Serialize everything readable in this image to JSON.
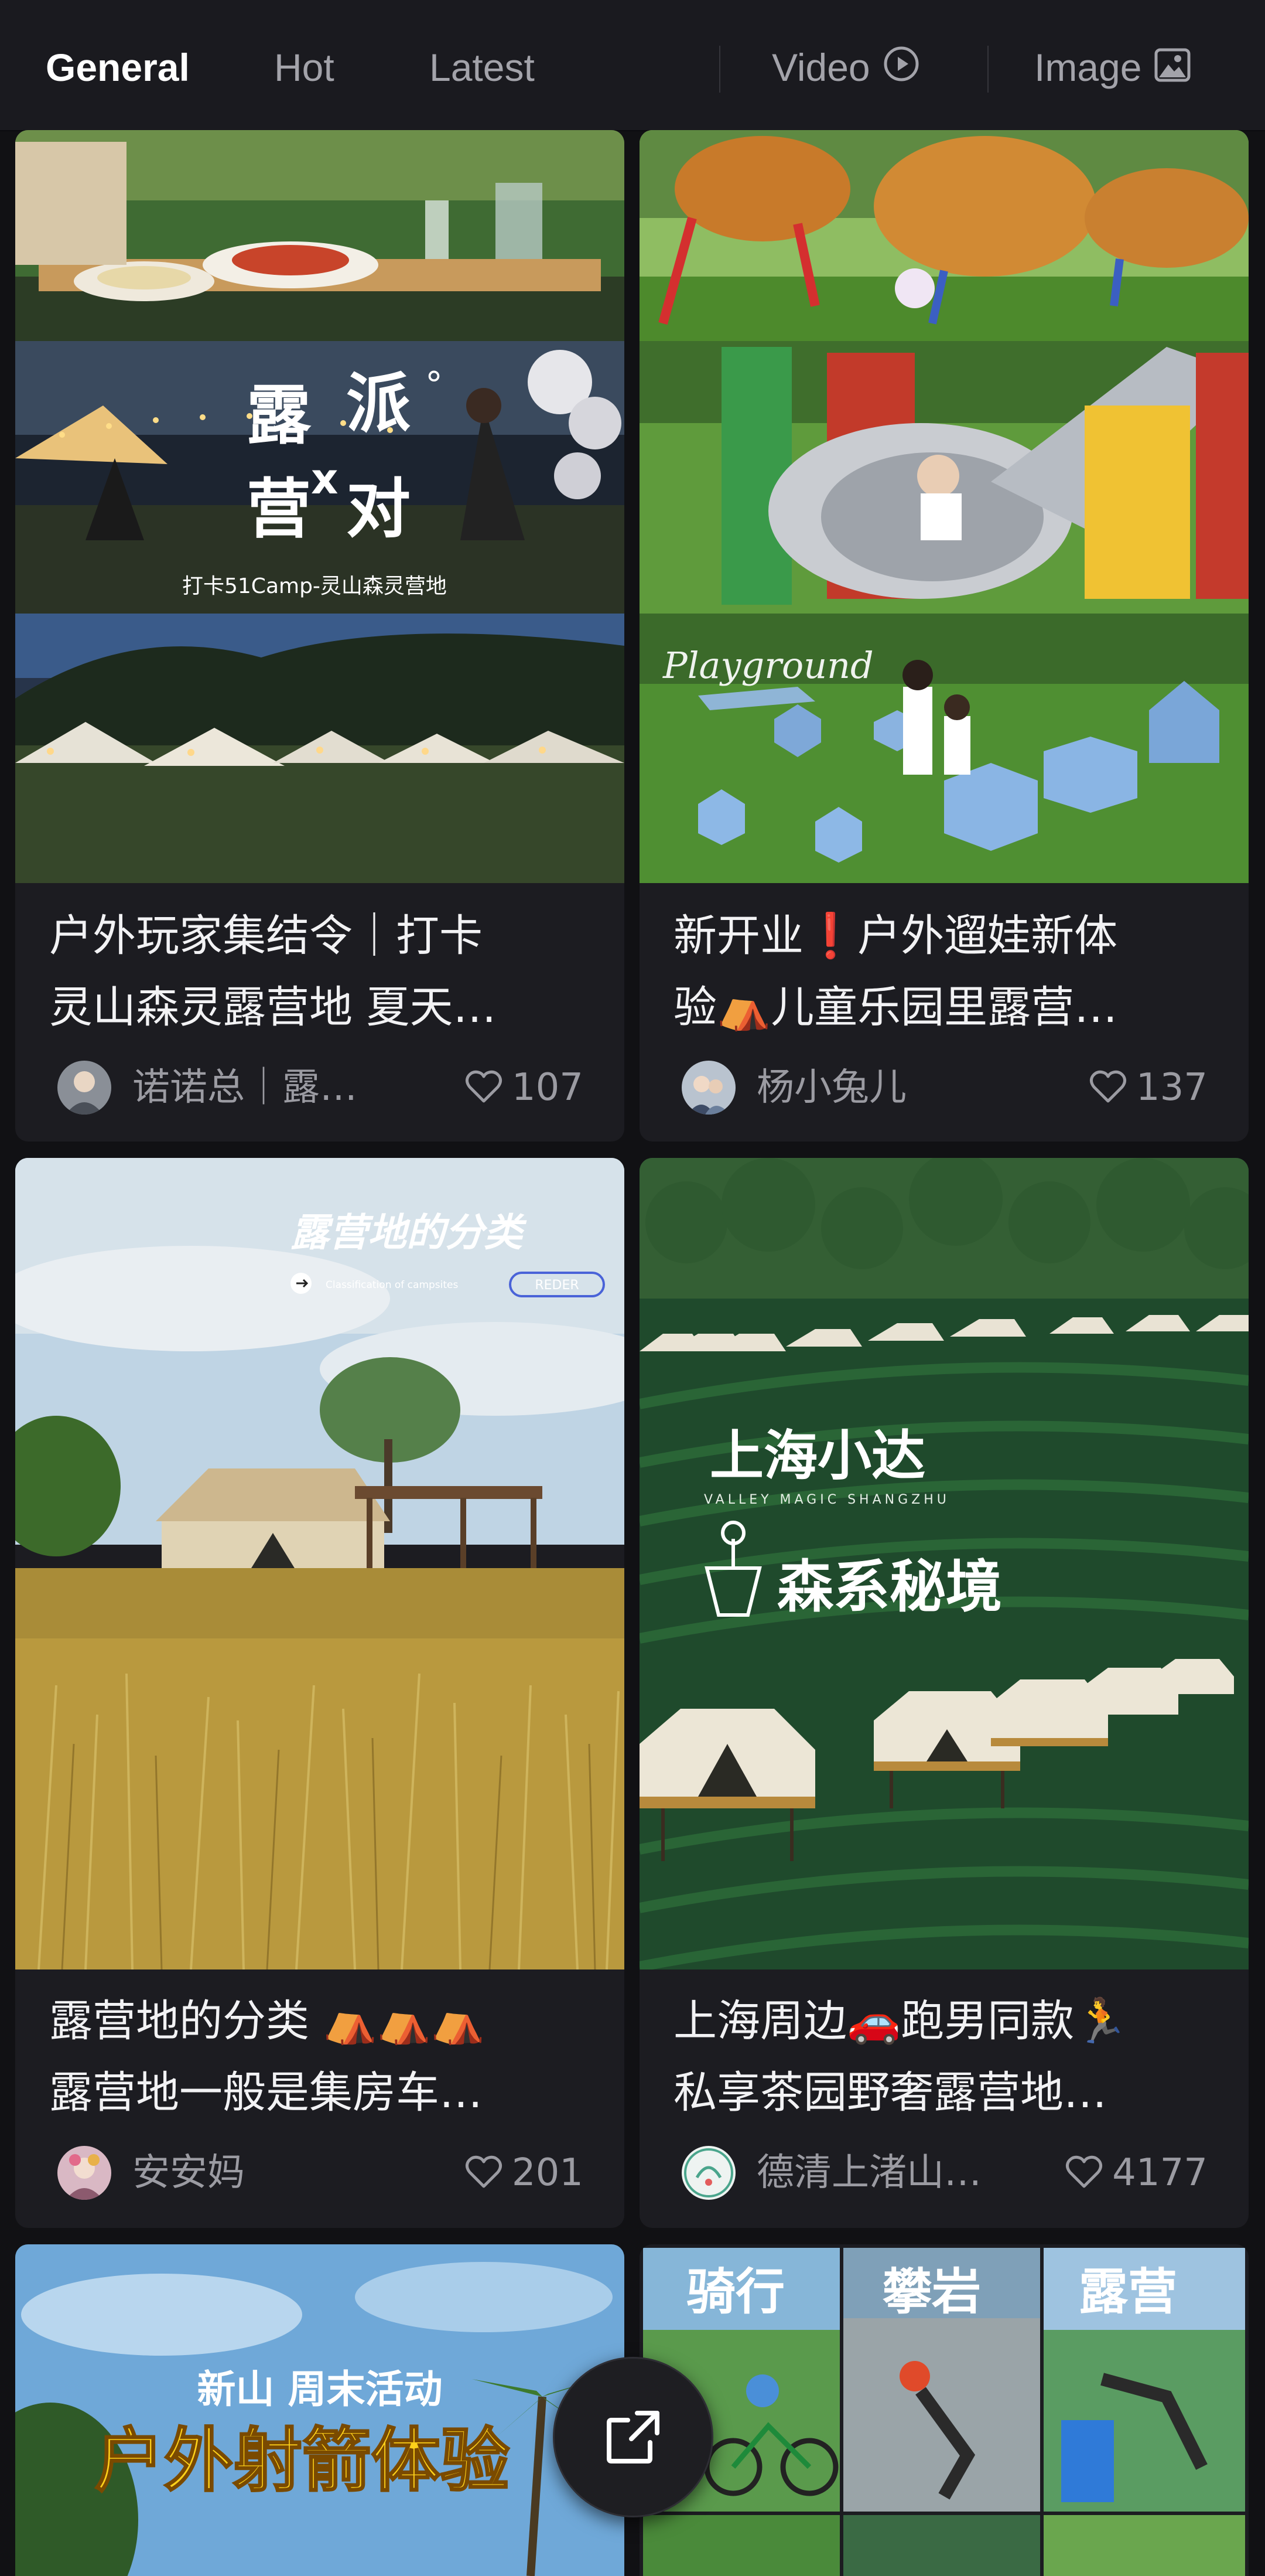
{
  "tabs": [
    {
      "label": "General",
      "active": true
    },
    {
      "label": "Hot",
      "active": false
    },
    {
      "label": "Latest",
      "active": false
    },
    {
      "label": "Video",
      "icon": "play-circle-icon",
      "active": false
    },
    {
      "label": "Image",
      "icon": "image-icon",
      "active": false
    }
  ],
  "cards": [
    {
      "title_lines": [
        "户外玩家集结令｜打卡",
        "灵山森灵露营地 夏天…"
      ],
      "author": "诺诺总｜露…",
      "likes": "107",
      "thumb_text": {
        "big1": "露",
        "big2": "派",
        "big3": "营",
        "big4": "对",
        "cross": "x",
        "degree": "°",
        "caption": "打卡51Camp-灵山森灵营地"
      }
    },
    {
      "title_lines": [
        "新开业❗户外遛娃新体",
        "验⛺儿童乐园里露营…"
      ],
      "author": "杨小兔儿",
      "likes": "137",
      "thumb_text": {
        "script": "Playground"
      }
    },
    {
      "title_lines": [
        "露营地的分类 ⛺⛺⛺",
        "露营地一般是集房车…"
      ],
      "author": "安安妈",
      "likes": "201",
      "thumb_text": {
        "headline": "露营地的分类",
        "sub": "Classification of campsites",
        "button": "REDER"
      }
    },
    {
      "title_lines": [
        "上海周边🚗跑男同款🏃",
        "私享茶园野奢露营地…"
      ],
      "author": "德清上渚山…",
      "likes": "4177",
      "thumb_text": {
        "line1": "上海小达",
        "sub": "VALLEY MAGIC SHANGZHU",
        "line2": "森系秘境"
      }
    },
    {
      "thumb_text": {
        "line1": "新山 周末活动",
        "line2": "户外射箭体验"
      }
    },
    {
      "thumb_text": {
        "a": "骑行",
        "b": "攀岩",
        "c": "露营"
      }
    }
  ],
  "colors": {
    "background": "#111114",
    "card": "#1c1c21",
    "tabbar": "#1a1a1f",
    "muted_text": "#9b9ba2",
    "accent_yellow": "#ffd21a"
  }
}
